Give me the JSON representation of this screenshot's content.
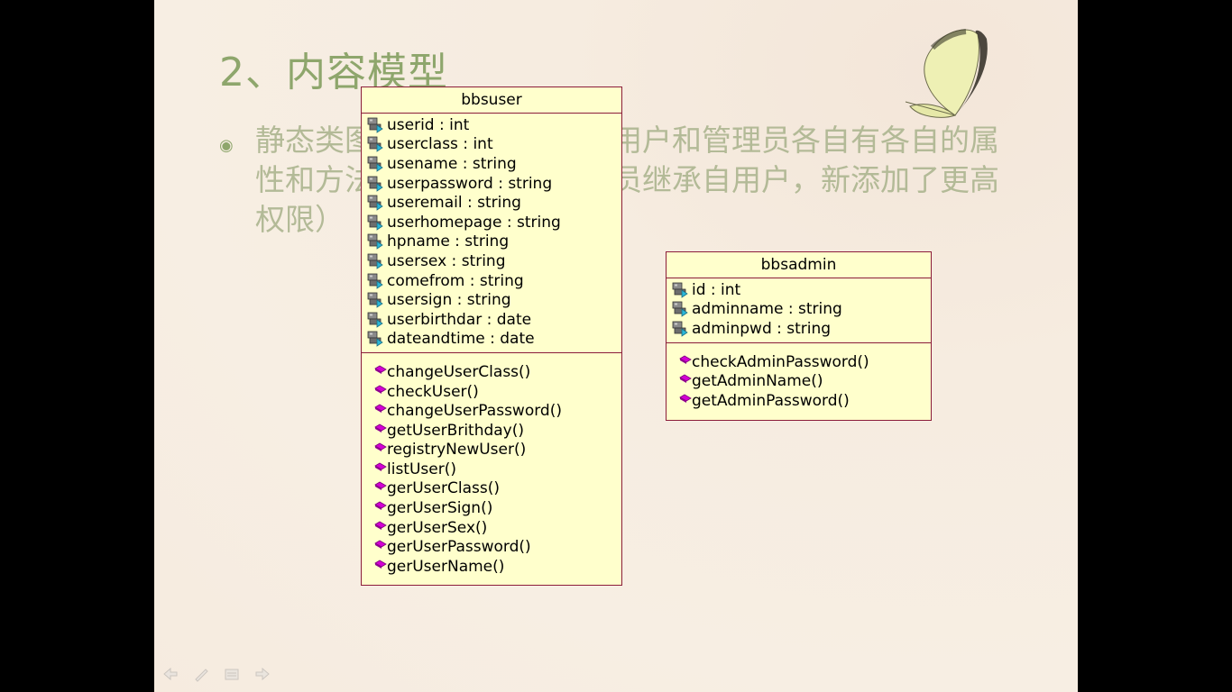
{
  "slide": {
    "title": "2、内容模型",
    "bullet_line1": "静态类图　　　　　　　　用户和管理员各自有各自的属",
    "bullet_line2": "性和方法　　　　　　　　员继承自用户，新添加了更高",
    "bullet_line3": "权限）"
  },
  "bbsuser": {
    "name": "bbsuser",
    "attributes": [
      "userid : int",
      "userclass : int",
      "usename : string",
      "userpassword : string",
      "useremail : string",
      "userhomepage : string",
      "hpname : string",
      "usersex : string",
      "comefrom : string",
      "usersign : string",
      "userbirthdar : date",
      "dateandtime : date"
    ],
    "operations": [
      "changeUserClass()",
      "checkUser()",
      "changeUserPassword()",
      "getUserBrithday()",
      "registryNewUser()",
      "listUser()",
      "gerUserClass()",
      "gerUserSign()",
      "gerUserSex()",
      "gerUserPassword()",
      "gerUserName()"
    ]
  },
  "bbsadmin": {
    "name": "bbsadmin",
    "attributes": [
      "id : int",
      "adminname : string",
      "adminpwd : string"
    ],
    "operations": [
      "checkAdminPassword()",
      "getAdminName()",
      "getAdminPassword()"
    ]
  },
  "colors": {
    "title": "#8ea66c",
    "body_text": "#b3ba97",
    "uml_fill": "#ffffcc",
    "uml_border": "#8b1c3a",
    "operation_icon": "#d400d4",
    "attribute_icon": "#2bb7d8"
  },
  "icons": {
    "attribute": "private-attribute-icon",
    "operation": "public-operation-icon",
    "nav": [
      "previous-slide-icon",
      "pen-icon",
      "menu-icon",
      "next-slide-icon"
    ]
  }
}
